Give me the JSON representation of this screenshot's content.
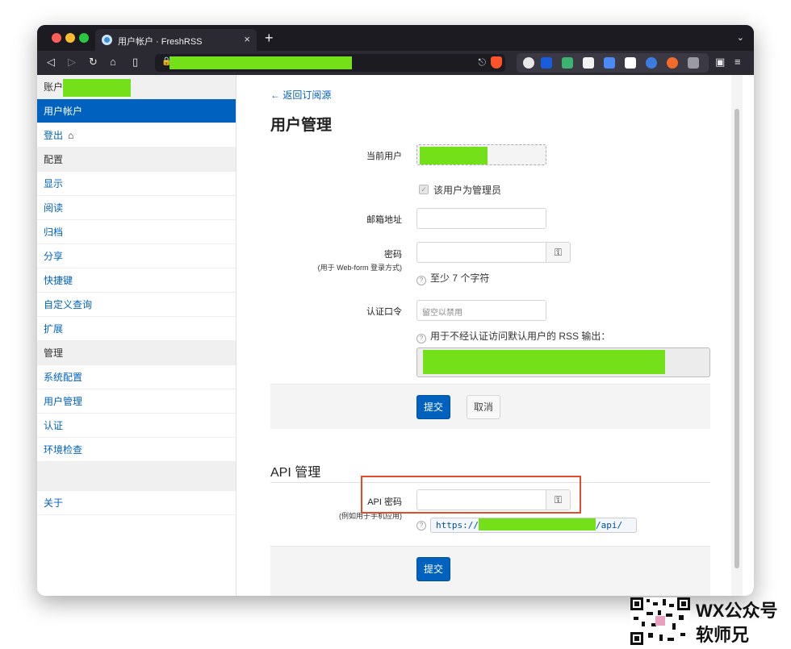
{
  "browser": {
    "tab_title": "用户帐户 · FreshRSS",
    "tab_close": "×",
    "new_tab": "+",
    "url": "https://"
  },
  "colors": {
    "accent": "#0062be",
    "redacted": "#74e01a",
    "highlight": "#e34b2b"
  },
  "sidebar": {
    "account_label": "账户",
    "items": [
      {
        "label": "用户帐户",
        "type": "active"
      },
      {
        "label": "登出",
        "type": "link",
        "icon": "lock-icon"
      },
      {
        "label": "配置",
        "type": "header"
      },
      {
        "label": "显示",
        "type": "link"
      },
      {
        "label": "阅读",
        "type": "link"
      },
      {
        "label": "归档",
        "type": "link"
      },
      {
        "label": "分享",
        "type": "link"
      },
      {
        "label": "快捷键",
        "type": "link"
      },
      {
        "label": "自定义查询",
        "type": "link"
      },
      {
        "label": "扩展",
        "type": "link"
      },
      {
        "label": "管理",
        "type": "header"
      },
      {
        "label": "系统配置",
        "type": "link"
      },
      {
        "label": "用户管理",
        "type": "link"
      },
      {
        "label": "认证",
        "type": "link"
      },
      {
        "label": "环境检查",
        "type": "link"
      },
      {
        "label": "",
        "type": "header"
      },
      {
        "label": "关于",
        "type": "link"
      }
    ]
  },
  "main": {
    "back_link": "← 返回订阅源",
    "title": "用户管理",
    "current_user_label": "当前用户",
    "is_admin_label": "该用户为管理员",
    "email_label": "邮箱地址",
    "password_label": "密码",
    "password_sublabel": "(用于 Web-form 登录方式)",
    "password_hint": "至少 7 个字符",
    "token_label": "认证口令",
    "token_placeholder": "留空以禁用",
    "token_hint": "用于不经认证访问默认用户的 RSS 输出：",
    "submit": "提交",
    "cancel": "取消",
    "api_title": "API 管理",
    "api_password_label": "API 密码",
    "api_password_sublabel": "(例如用于手机应用)",
    "api_url_prefix": "https://",
    "api_url_suffix": "/api/",
    "api_submit": "提交"
  },
  "watermark": {
    "line1": "WX公众号",
    "line2": "软师兄"
  }
}
